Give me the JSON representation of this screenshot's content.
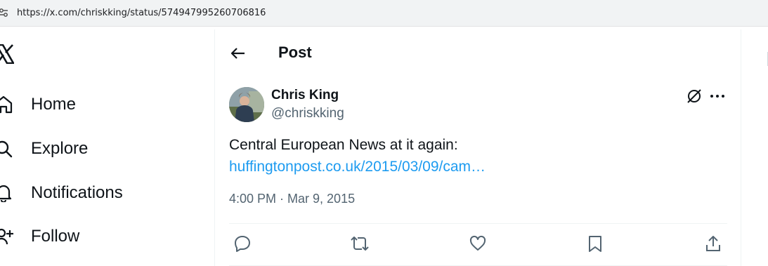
{
  "browser": {
    "url": "https://x.com/chriskking/status/574947995260706816"
  },
  "nav": {
    "items": [
      {
        "label": "Home",
        "icon": "home-icon"
      },
      {
        "label": "Explore",
        "icon": "search-icon"
      },
      {
        "label": "Notifications",
        "icon": "bell-icon"
      },
      {
        "label": "Follow",
        "icon": "follow-icon"
      }
    ]
  },
  "header": {
    "title": "Post"
  },
  "post": {
    "author_name": "Chris King",
    "author_handle": "@chriskking",
    "text": "Central European News at it again:",
    "link": "huffingtonpost.co.uk/2015/03/09/cam…",
    "timestamp": "4:00 PM · Mar 9, 2015"
  },
  "colors": {
    "accent": "#1d9bf0",
    "text": "#0f1419",
    "muted": "#536471",
    "border": "#eff3f4"
  }
}
